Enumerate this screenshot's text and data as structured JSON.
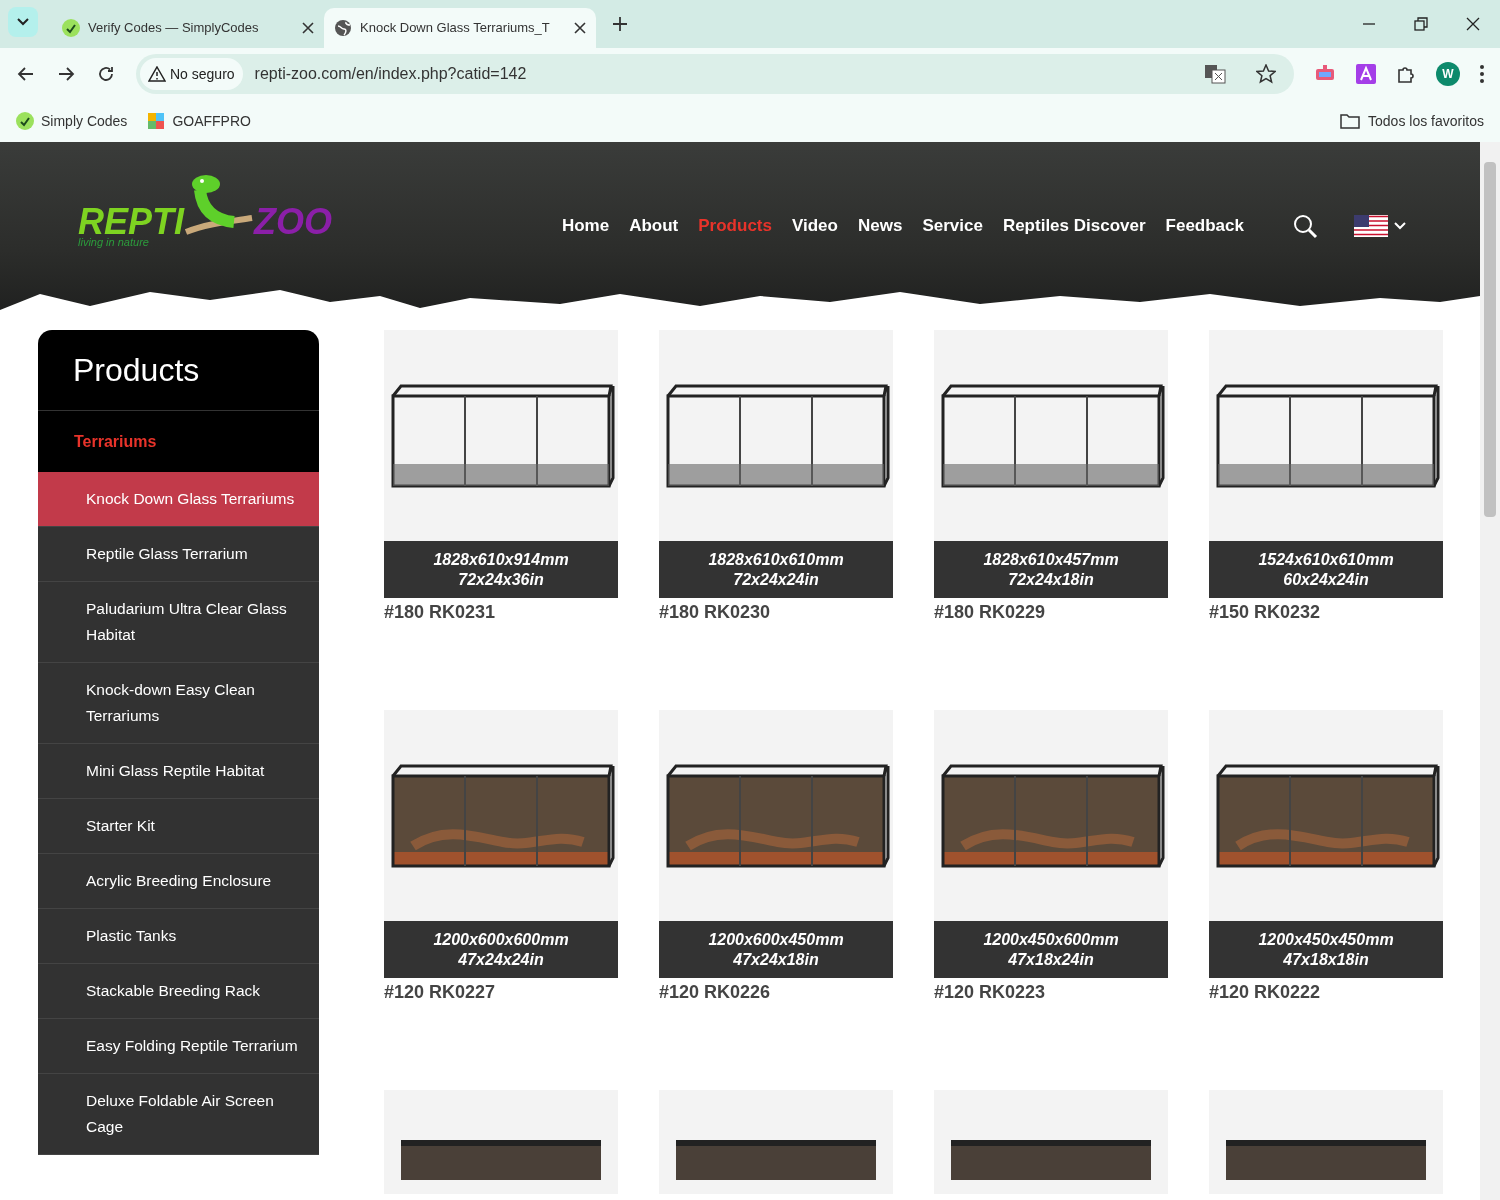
{
  "browser": {
    "tabs": [
      {
        "title": "Verify Codes — SimplyCodes",
        "selected": false,
        "kind": "simplycodes"
      },
      {
        "title": "Knock Down Glass Terrariums_T",
        "selected": true,
        "kind": "globe"
      }
    ],
    "security": "No seguro",
    "url": "repti-zoo.com/en/index.php?catid=142",
    "profile": "W",
    "bookmarks": [
      {
        "label": "Simply Codes",
        "kind": "simplycodes"
      },
      {
        "label": "GOAFFPRO",
        "kind": "puzzle"
      }
    ],
    "all_bookmarks": "Todos los favoritos"
  },
  "site": {
    "logo": {
      "left": "REPTI",
      "right": "ZOO",
      "tagline": "living in nature"
    },
    "nav": [
      {
        "label": "Home",
        "selected": false
      },
      {
        "label": "About",
        "selected": false
      },
      {
        "label": "Products",
        "selected": true
      },
      {
        "label": "Video",
        "selected": false
      },
      {
        "label": "News",
        "selected": false
      },
      {
        "label": "Service",
        "selected": false
      },
      {
        "label": "Reptiles Discover",
        "selected": false
      },
      {
        "label": "Feedback",
        "selected": false
      }
    ]
  },
  "sidebar": {
    "title": "Products",
    "category": "Terrariums",
    "items": [
      {
        "label": "Knock Down Glass Terrariums",
        "selected": true
      },
      {
        "label": "Reptile Glass Terrarium",
        "selected": false
      },
      {
        "label": "Paludarium Ultra Clear Glass Habitat",
        "selected": false
      },
      {
        "label": "Knock-down Easy Clean Terrariums",
        "selected": false
      },
      {
        "label": "Mini Glass Reptile Habitat",
        "selected": false
      },
      {
        "label": "Starter Kit",
        "selected": false
      },
      {
        "label": "Acrylic Breeding Enclosure",
        "selected": false
      },
      {
        "label": "Plastic Tanks",
        "selected": false
      },
      {
        "label": "Stackable Breeding Rack",
        "selected": false
      },
      {
        "label": "Easy Folding Reptile Terrarium",
        "selected": false
      },
      {
        "label": "Deluxe Foldable Air Screen Cage",
        "selected": false
      }
    ]
  },
  "products": [
    {
      "kind": "empty",
      "size_mm": "1828x610x914mm",
      "size_in": "72x24x36in",
      "code": "#180 RK0231"
    },
    {
      "kind": "empty",
      "size_mm": "1828x610x610mm",
      "size_in": "72x24x24in",
      "code": "#180 RK0230"
    },
    {
      "kind": "empty",
      "size_mm": "1828x610x457mm",
      "size_in": "72x24x18in",
      "code": "#180 RK0229"
    },
    {
      "kind": "empty",
      "size_mm": "1524x610x610mm",
      "size_in": "60x24x24in",
      "code": "#150 RK0232"
    },
    {
      "kind": "furnished",
      "size_mm": "1200x600x600mm",
      "size_in": "47x24x24in",
      "code": "#120 RK0227"
    },
    {
      "kind": "furnished",
      "size_mm": "1200x600x450mm",
      "size_in": "47x24x18in",
      "code": "#120 RK0226"
    },
    {
      "kind": "furnished",
      "size_mm": "1200x450x600mm",
      "size_in": "47x18x24in",
      "code": "#120 RK0223"
    },
    {
      "kind": "furnished",
      "size_mm": "1200x450x450mm",
      "size_in": "47x18x18in",
      "code": "#120 RK0222"
    },
    {
      "kind": "partial"
    },
    {
      "kind": "partial"
    },
    {
      "kind": "partial"
    },
    {
      "kind": "partial"
    }
  ]
}
